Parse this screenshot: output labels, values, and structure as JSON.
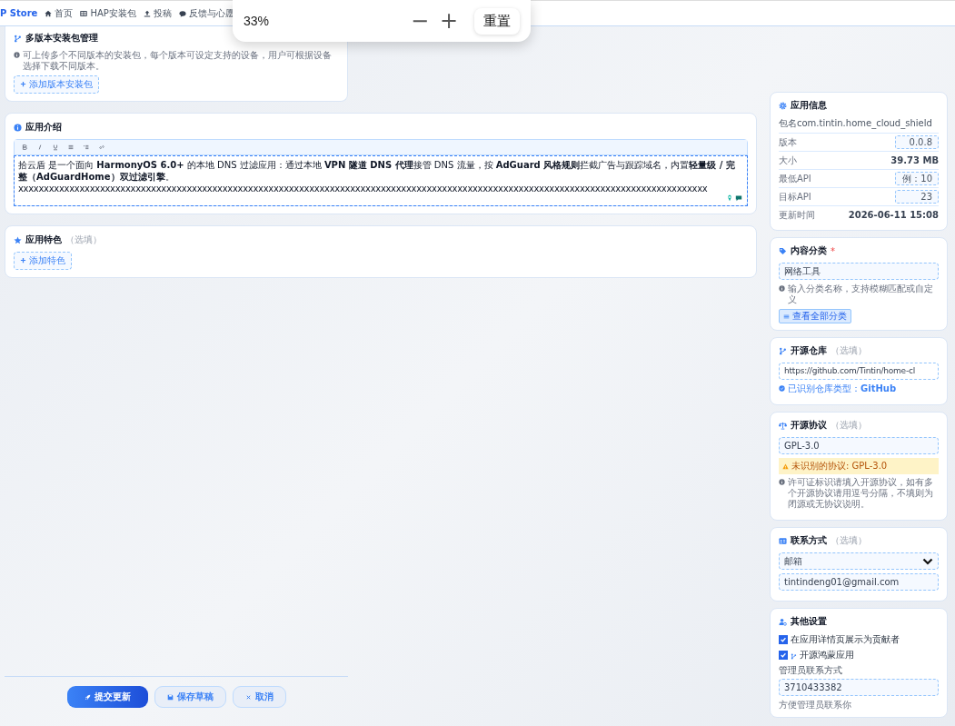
{
  "header": {
    "brand": "P Store",
    "nav": [
      {
        "label": "首页"
      },
      {
        "label": "HAP安装包"
      },
      {
        "label": "投稿"
      },
      {
        "label": "反馈与心愿"
      }
    ]
  },
  "zoom_popup": {
    "level": "33%",
    "minus": "−",
    "plus": "+",
    "reset": "重置"
  },
  "versions": {
    "title": "多版本安装包管理",
    "hint": "可上传多个不同版本的安装包，每个版本可设定支持的设备，用户可根据设备选择下载不同版本。",
    "add": "添加版本安装包"
  },
  "intro": {
    "title": "应用介绍",
    "paragraph": "拾云盾 是一个面向 **HarmonyOS 6.0+** 的本地 DNS 过滤应用：通过本地 **VPN 隧道 DNS 代理**接管 DNS 流量，按 **AdGuard 风格规则**拦截广告与跟踪域名，内置**轻量级 / 完整（AdGuardHome）双过滤引擎**。",
    "line_2": "xxxxxxxxxxxxxxxxxxxxxxxxxxxxxxxxxxxxxxxxxxxxxxxxxxxxxxxxxxxxxxxxxxxxxxxxxxxxxxxxxxxxxxxxxxxxxxxxxxxxxxxxxxxxxxxxxxxxxxxxxxxxxxxxxxxxxxx"
  },
  "features": {
    "title": "应用特色",
    "optional": "（选填）",
    "add": "添加特色"
  },
  "app_info": {
    "title": "应用信息",
    "package": "包名com.tintin.home_cloud_shield",
    "rows": [
      {
        "label": "版本",
        "value": "0.0.8",
        "kind": "input"
      },
      {
        "label": "大小",
        "value": "39.73 MB",
        "kind": "text"
      },
      {
        "label": "最低API",
        "value": "例：10",
        "kind": "input"
      },
      {
        "label": "目标API",
        "value": "23",
        "kind": "input"
      },
      {
        "label": "更新时间",
        "value": "2026-06-11 15:08",
        "kind": "text"
      }
    ]
  },
  "category": {
    "title": "内容分类",
    "required": "*",
    "value": "网络工具",
    "hint": "输入分类名称，支持模糊匹配或自定义",
    "button": "查看全部分类"
  },
  "repo": {
    "title": "开源仓库",
    "optional": "（选填）",
    "value": "https://github.com/Tintin/home-cl",
    "detected": "已识别仓库类型：",
    "detected_type": "GitHub"
  },
  "license": {
    "title": "开源协议",
    "optional": "（选填）",
    "value": "GPL-3.0",
    "warning": "未识别的协议: GPL-3.0",
    "hint": "许可证标识请填入开源协议，如有多个开源协议请用逗号分隔，不填则为闭源或无协议说明。"
  },
  "contact": {
    "title": "联系方式",
    "optional": "（选填）",
    "method": "邮箱",
    "value": "tintindeng01@gmail.com"
  },
  "other": {
    "title": "其他设置",
    "options": [
      {
        "label": "在应用详情页展示为贡献者",
        "checked": true,
        "icon": false
      },
      {
        "label": "开源鸿蒙应用",
        "checked": true,
        "icon": true
      }
    ],
    "admin_label": "管理员联系方式",
    "admin_value": "3710433382",
    "admin_hint": "方便管理员联系你"
  },
  "actions": {
    "submit": "提交更新",
    "draft": "保存草稿",
    "cancel": "取消"
  }
}
